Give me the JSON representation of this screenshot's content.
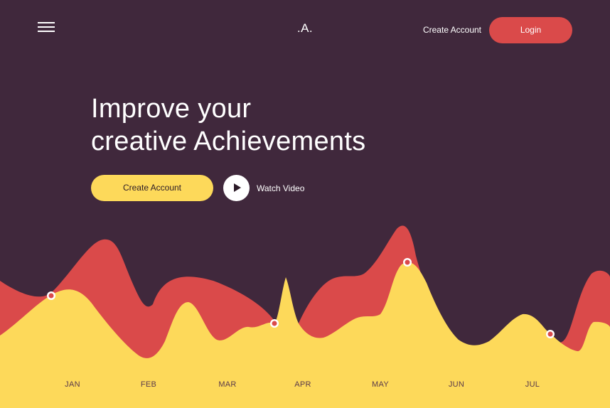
{
  "header": {
    "logo": ".A.",
    "menu_icon": "hamburger-menu-icon",
    "create_account_label": "Create Account",
    "login_label": "Login"
  },
  "hero": {
    "headline_line1": "Improve your",
    "headline_line2": "creative Achievements",
    "create_account_label": "Create Account",
    "watch_video_label": "Watch Video",
    "play_icon": "play-icon"
  },
  "colors": {
    "background": "#40283c",
    "accent_red": "#da4a4a",
    "accent_yellow": "#fdd95a",
    "text_light": "#ffffff",
    "text_dark": "#2b1a27",
    "month_label": "#5a3a4a"
  },
  "chart_data": {
    "type": "area",
    "title": "",
    "xlabel": "",
    "ylabel": "",
    "categories": [
      "JAN",
      "FEB",
      "MAR",
      "APR",
      "MAY",
      "JUN",
      "JUL"
    ],
    "grid": false,
    "legend": "none",
    "series": [
      {
        "color": "#da4a4a"
      },
      {
        "color": "#fdd95a",
        "highlighted_points": 5
      }
    ]
  }
}
